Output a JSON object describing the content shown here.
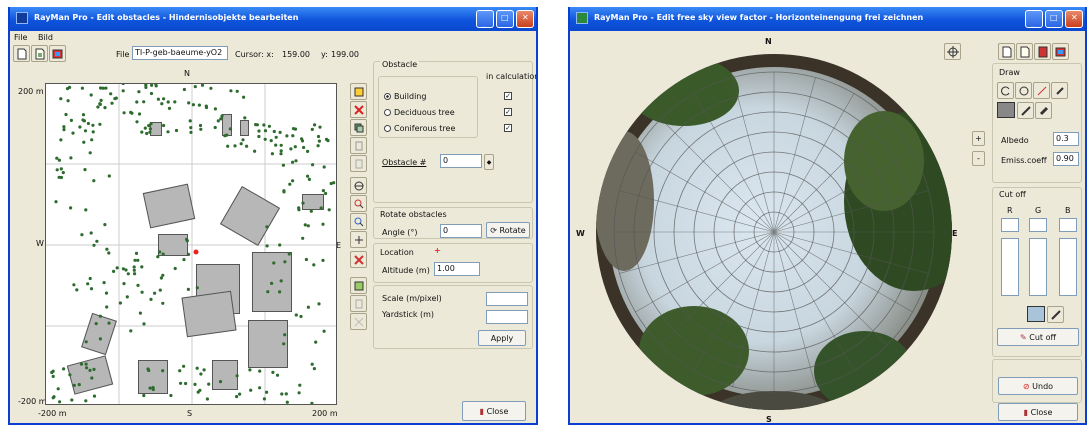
{
  "left": {
    "title": "RayMan Pro - Edit obstacles - Hindernisobjekte bearbeiten",
    "menu": [
      "File",
      "Bild"
    ],
    "file_label": "File",
    "file_value": "TI-P-geb-baeume-yO2",
    "cursor_label": "Cursor: x:",
    "cursor_x": "159.00",
    "cursor_y_label": "y:",
    "cursor_y": "199.00",
    "map": {
      "north": "N",
      "south": "S",
      "west": "W",
      "east": "E",
      "top_left": "200 m",
      "bottom_left": "-200 m",
      "x_min": "-200 m",
      "x_max": "200 m"
    },
    "obstacle": {
      "heading": "Obstacle",
      "in_calc": "in calculation",
      "options": [
        "Building",
        "Deciduous tree",
        "Coniferous tree"
      ],
      "selected": 0,
      "obstacle_no_label": "Obstacle #",
      "obstacle_no": "0"
    },
    "rotate": {
      "heading": "Rotate obstacles",
      "angle_label": "Angle (°)",
      "angle_value": "0",
      "button": "Rotate"
    },
    "location": {
      "heading": "Location",
      "marker": "+",
      "altitude_label": "Altitude (m)",
      "altitude_value": "1.00"
    },
    "scale": {
      "scale_label": "Scale (m/pixel)",
      "yardstick_label": "Yardstick (m)",
      "apply": "Apply"
    },
    "close": "Close"
  },
  "right": {
    "title": "RayMan Pro - Edit free sky view factor - Horizonteinengung frei zeichnen",
    "compass": {
      "north": "N",
      "south": "S",
      "west": "W",
      "east": "E"
    },
    "draw_heading": "Draw",
    "albedo_label": "Albedo",
    "albedo_value": "0.3",
    "emiss_label": "Emiss.coeff",
    "emiss_value": "0.90",
    "cutoff_heading": "Cut off",
    "rgb": [
      "R",
      "G",
      "B"
    ],
    "cutoff_button": "Cut off",
    "undo": "Undo",
    "close": "Close",
    "plus": "+",
    "minus": "-"
  },
  "colors": {
    "titlebar": "#0f54dc",
    "tree_dot": "#2e6b2e",
    "building": "#b7b7b7",
    "window_bg": "#ece9d8"
  }
}
